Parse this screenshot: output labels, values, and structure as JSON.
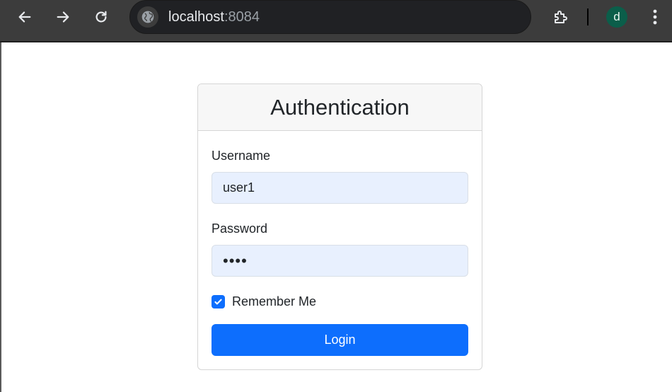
{
  "browser": {
    "url_host": "localhost",
    "url_port": ":8084",
    "profile_initial": "d",
    "icons": {
      "back": "arrow-left-icon",
      "forward": "arrow-right-icon",
      "reload": "reload-icon",
      "site_info": "globe-icon",
      "extensions": "puzzle-icon",
      "menu": "kebab-menu-icon"
    },
    "colors": {
      "toolbar": "#3c3c3c",
      "omnibox": "#202124",
      "avatar": "#0b5e4a"
    }
  },
  "form": {
    "title": "Authentication",
    "username_label": "Username",
    "username_value": "user1",
    "password_label": "Password",
    "password_value": "••••",
    "remember_label": "Remember Me",
    "remember_checked": true,
    "login_label": "Login",
    "colors": {
      "primary": "#0d6efd",
      "input_background": "#e8f0fe",
      "header_background": "#f7f7f7"
    }
  }
}
